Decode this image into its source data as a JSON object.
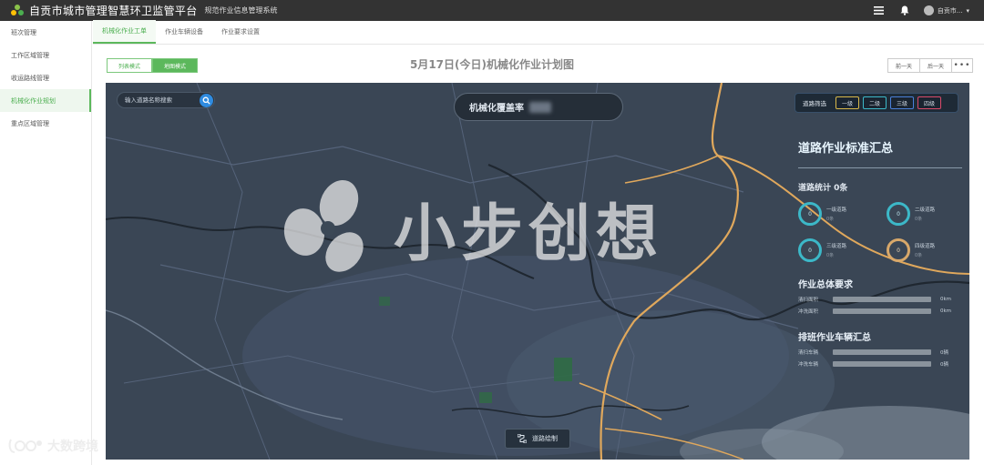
{
  "app": {
    "title": "自贡市城市管理智慧环卫监管平台",
    "subtitle": "规范作业信息管理系统",
    "user": "自贡市..."
  },
  "icons": {
    "menu": "menu-icon",
    "bell": "bell-icon",
    "avatar": "user-avatar",
    "caret": "caret-down-icon"
  },
  "sidebar": {
    "items": [
      {
        "label": "班次管理"
      },
      {
        "label": "工作区域管理"
      },
      {
        "label": "收运路线管理"
      },
      {
        "label": "机械化作业规划"
      },
      {
        "label": "重点区域管理"
      }
    ],
    "active_index": 3
  },
  "tabs": [
    {
      "label": "机械化作业工单"
    },
    {
      "label": "作业车辆设备"
    },
    {
      "label": "作业要求设置"
    }
  ],
  "toolbar": {
    "list_mode": "列表模式",
    "map_mode": "地图模式",
    "plan_title": "5月17日(今日)机械化作业计划图",
    "prev_day": "前一天",
    "next_day": "后一天",
    "more": "•••"
  },
  "map": {
    "search_placeholder": "输入道路名称搜索",
    "coverage_label": "机械化覆盖率",
    "filter_label": "道路筛选",
    "levels": [
      {
        "label": "一级",
        "color": "#d8b84a"
      },
      {
        "label": "二级",
        "color": "#3cb8c8"
      },
      {
        "label": "三级",
        "color": "#4a7fd8"
      },
      {
        "label": "四级",
        "color": "#d84a6a"
      }
    ],
    "summary": {
      "title": "道路作业标准汇总",
      "count_label": "道路统计 0条",
      "rings": [
        {
          "value": "0",
          "label": "一级道路",
          "sub": "0条",
          "tone": "teal"
        },
        {
          "value": "0",
          "label": "二级道路",
          "sub": "0条",
          "tone": "teal"
        },
        {
          "value": "0",
          "label": "三级道路",
          "sub": "0条",
          "tone": "teal"
        },
        {
          "value": "0",
          "label": "四级道路",
          "sub": "0条",
          "tone": "orange"
        }
      ],
      "requirements_title": "作业总体要求",
      "requirements": [
        {
          "label": "清扫面积",
          "value": "0km",
          "fraction": 0
        },
        {
          "label": "冲洗面积",
          "value": "0km",
          "fraction": 0
        }
      ],
      "vehicles_title": "排班作业车辆汇总",
      "vehicles": [
        {
          "label": "清扫车辆",
          "value": "0辆",
          "fraction": 0
        },
        {
          "label": "冲洗车辆",
          "value": "0辆",
          "fraction": 0
        }
      ]
    },
    "draw_button": "道路绘制",
    "watermark": "小步创想"
  },
  "corner_watermark": "大数跨境",
  "colors": {
    "accent": "#5cb85c",
    "topbar": "#333333",
    "map_bg": "#3b4856",
    "road": "#e0a85c"
  }
}
